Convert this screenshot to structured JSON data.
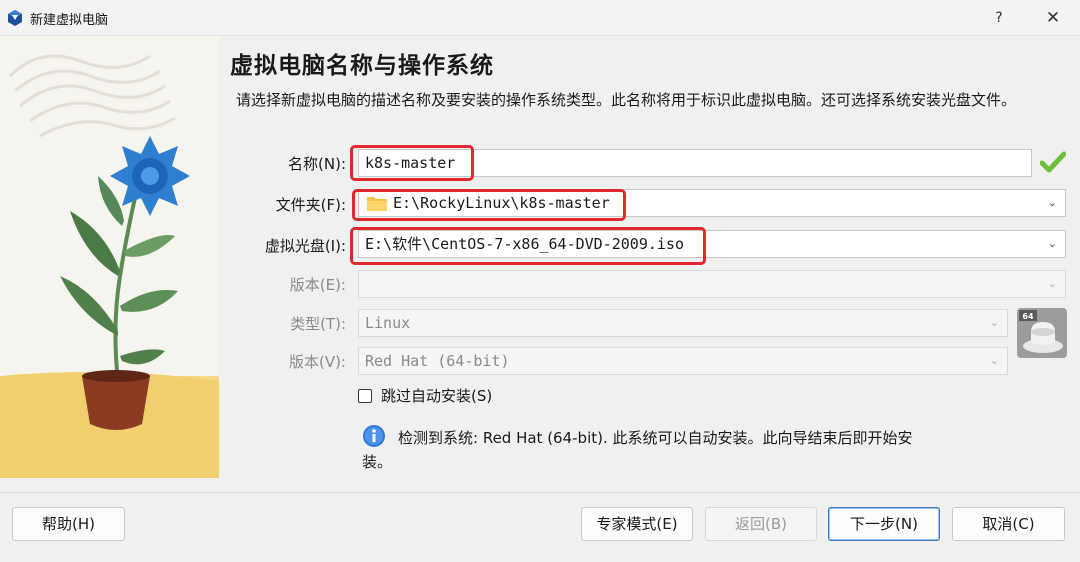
{
  "window": {
    "title": "新建虚拟电脑",
    "help_label": "?",
    "close_label": "✕"
  },
  "header": {
    "title": "虚拟电脑名称与操作系统",
    "description": "请选择新虚拟电脑的描述名称及要安装的操作系统类型。此名称将用于标识此虚拟电脑。还可选择系统安装光盘文件。"
  },
  "form": {
    "name_label": "名称(N):",
    "name_value": "k8s-master",
    "folder_label": "文件夹(F):",
    "folder_value": "E:\\RockyLinux\\k8s-master",
    "iso_label": "虚拟光盘(I):",
    "iso_value": "E:\\软件\\CentOS-7-x86_64-DVD-2009.iso",
    "edition_label": "版本(E):",
    "edition_value": "",
    "type_label": "类型(T):",
    "type_value": "Linux",
    "version_label": "版本(V):",
    "version_value": "Red Hat (64-bit)",
    "os_badge": "64"
  },
  "unattended": {
    "checkbox_label": "跳过自动安装(S)",
    "checked": false
  },
  "info": {
    "line1": "检测到系统: Red Hat (64-bit). 此系统可以自动安装。此向导结束后即开始安",
    "line2": "装。"
  },
  "footer": {
    "help_button": "帮助(H)",
    "expert_button": "专家模式(E)",
    "back_button": "返回(B)",
    "next_button": "下一步(N)",
    "cancel_button": "取消(C)"
  },
  "colors": {
    "highlight_box": "#e0282e",
    "valid_check": "#6abf3b",
    "info_icon": "#2f78d8"
  }
}
